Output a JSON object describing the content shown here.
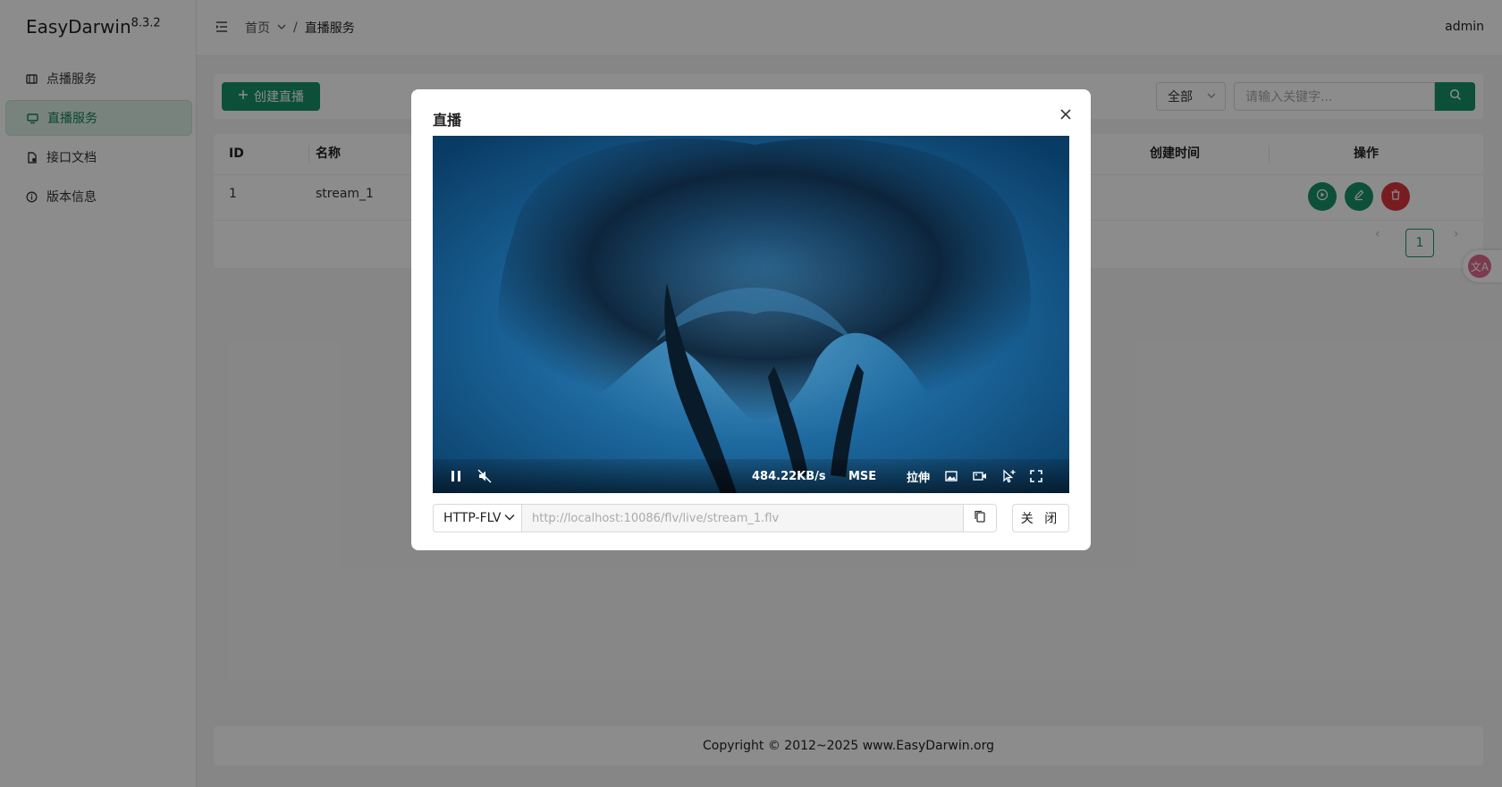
{
  "app": {
    "name": "EasyDarwin",
    "version": "8.3.2"
  },
  "sidebar": {
    "items": [
      {
        "label": "点播服务",
        "icon": "film-icon",
        "active": false
      },
      {
        "label": "直播服务",
        "icon": "monitor-icon",
        "active": true
      },
      {
        "label": "接口文档",
        "icon": "document-icon",
        "active": false
      },
      {
        "label": "版本信息",
        "icon": "info-icon",
        "active": false
      }
    ]
  },
  "header": {
    "breadcrumb": {
      "home": "首页",
      "current": "直播服务",
      "separator": "/"
    },
    "user": "admin"
  },
  "toolbar": {
    "create_label": "创建直播",
    "filter_value": "全部",
    "search_placeholder": "请输入关键字..."
  },
  "table": {
    "columns": [
      "ID",
      "名称",
      "创建时间",
      "操作"
    ],
    "rows": [
      {
        "id": "1",
        "name": "stream_1"
      }
    ]
  },
  "pagination": {
    "current": "1"
  },
  "footer": {
    "copyright": "Copyright © 2012~2025 www.EasyDarwin.org"
  },
  "modal": {
    "title": "直播",
    "player": {
      "speed": "484.22KB/s",
      "mode": "MSE",
      "stretch": "拉伸"
    },
    "protocol": "HTTP-FLV",
    "url_placeholder": "http://localhost:10086/flv/live/stream_1.flv",
    "close_label": "关 闭"
  },
  "colors": {
    "primary": "#16936b",
    "danger": "#d9363e",
    "active_bg": "#dcefe6"
  }
}
